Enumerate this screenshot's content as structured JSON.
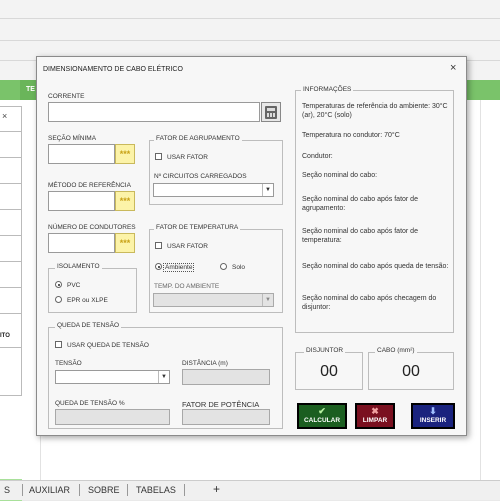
{
  "background": {
    "green_tab_label": "TE",
    "side_panel_text": "ITO",
    "sheet_tabs": [
      "AUXILIAR",
      "SOBRE",
      "TABELAS"
    ],
    "add_sheet": "+",
    "left_tab_fragment": "S"
  },
  "dialog": {
    "title": "DIMENSIONAMENTO DE CABO ELÉTRICO",
    "close_icon": "×",
    "corrente_label": "CORRENTE",
    "secao_minima_label": "SEÇÃO MÍNIMA",
    "metodo_label": "MÉTODO DE REFERÊNCIA",
    "num_condutores_label": "NÚMERO DE CONDUTORES",
    "dots": "***",
    "isolamento": {
      "label": "ISOLAMENTO",
      "option_pvc": "PVC",
      "option_epr": "EPR ou XLPE",
      "selected": "PVC"
    },
    "agrupamento": {
      "label": "FATOR DE AGRUPAMENTO",
      "usar_fator": "USAR FATOR",
      "circuitos_label": "Nº CIRCUITOS CARREGADOS"
    },
    "temperatura": {
      "label": "FATOR DE TEMPERATURA",
      "usar_fator": "USAR FATOR",
      "option_ambiente": "Ambiente",
      "option_solo": "Solo",
      "selected": "Ambiente",
      "temp_label": "TEMP.  DO AMBIENTE"
    },
    "queda": {
      "label": "QUEDA DE TENSÃO",
      "usar_queda": "USAR QUEDA DE TENSÃO",
      "tensao_label": "TENSÃO",
      "distancia_label": "DISTÂNCIA (m)",
      "queda_pct_label": "QUEDA DE TENSÃO %",
      "fator_potencia_label": "FATOR DE POTÊNCIA"
    },
    "informacoes": {
      "label": "INFORMAÇÕES",
      "lines": [
        "Temperaturas de referência do ambiente: 30°C (ar), 20°C (solo)",
        "Temperatura no condutor: 70°C",
        "Condutor:",
        "Seção nominal do cabo:",
        "Seção nominal do cabo após fator de agrupamento:",
        "Seção nominal do cabo após fator de temperatura:",
        "Seção nominal do cabo após queda de tensão:",
        "Seção nominal do cabo após checagem do disjuntor:"
      ]
    },
    "disjuntor": {
      "label": "DISJUNTOR",
      "value": "00"
    },
    "cabo": {
      "label": "CABO (mm²)",
      "value": "00"
    },
    "buttons": {
      "calcular": {
        "label": "CALCULAR",
        "icon": "✔",
        "color": "#1b5e20"
      },
      "limpar": {
        "label": "LIMPAR",
        "icon": "✖",
        "color": "#7a1020"
      },
      "inserir": {
        "label": "INSERIR",
        "icon": "⬇",
        "color": "#1a237e"
      }
    }
  }
}
